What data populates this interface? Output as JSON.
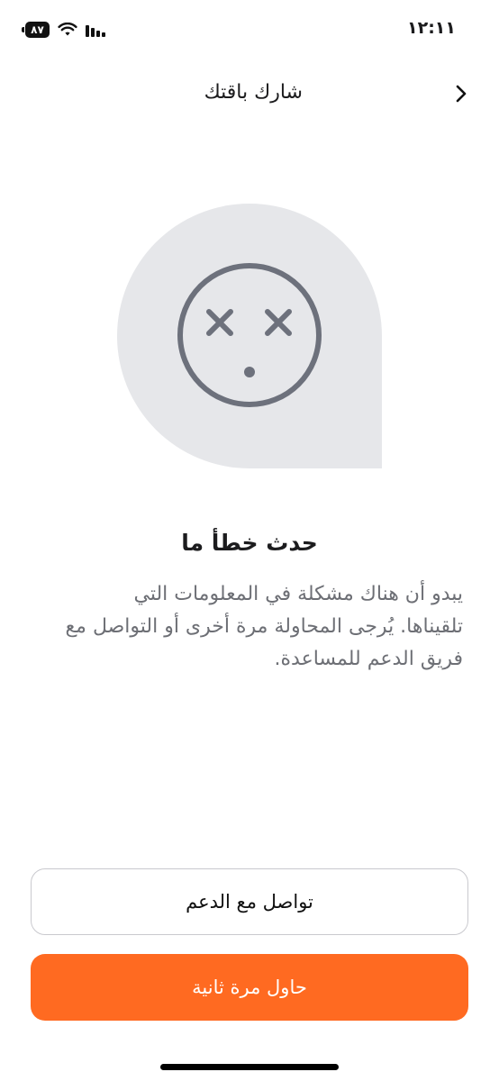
{
  "status_bar": {
    "time": "١٢:١١",
    "battery_level": "٨٧",
    "icons": [
      "signal-icon",
      "wifi-icon",
      "battery-icon"
    ]
  },
  "header": {
    "title": "شارك باقتك",
    "back_icon": "chevron-right-icon"
  },
  "error": {
    "illustration": "sad-face-icon",
    "title": "حدث خطأ ما",
    "message_lines": [
      "يبدو أن هناك مشكلة في المعلومات التي",
      "تلقيناها. يُرجى المحاولة مرة أخرى أو التواصل مع",
      "فريق الدعم للمساعدة."
    ]
  },
  "actions": {
    "contact_support_label": "تواصل مع الدعم",
    "retry_label": "حاول مرة ثانية"
  },
  "colors": {
    "accent": "#ff6a21",
    "illustration_bg": "#e6e7ea",
    "illustration_stroke": "#6d717c"
  }
}
